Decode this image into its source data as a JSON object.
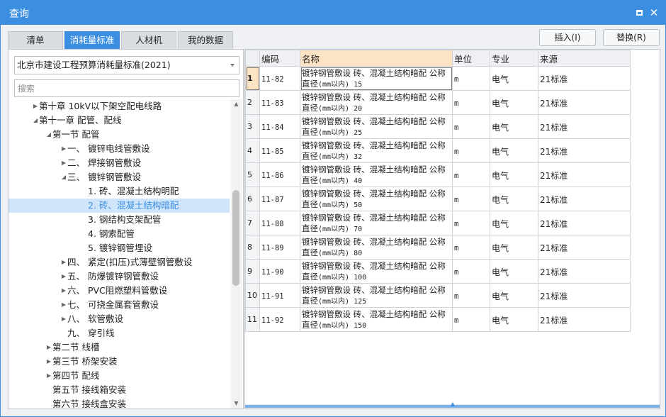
{
  "window": {
    "title": "查询"
  },
  "tabs": [
    {
      "label": "清单",
      "active": false
    },
    {
      "label": "消耗量标准",
      "active": true
    },
    {
      "label": "人材机",
      "active": false
    },
    {
      "label": "我的数据",
      "active": false
    }
  ],
  "toolbar": {
    "insert_label": "插入(I)",
    "replace_label": "替换(R)"
  },
  "standard_select": {
    "value": "北京市建设工程预算消耗量标准(2021)"
  },
  "search": {
    "placeholder": "搜索"
  },
  "tree": [
    {
      "label": "第十章 10kV以下架空配电线路",
      "toggle": "▶",
      "selected": false
    },
    {
      "label": "第十一章 配管、配线",
      "toggle": "◢",
      "selected": false
    },
    {
      "label": "第一节 配管",
      "toggle": "◢",
      "selected": false
    },
    {
      "label": "一、 镀锌电线管敷设",
      "toggle": "▶",
      "selected": false
    },
    {
      "label": "二、 焊接钢管敷设",
      "toggle": "▶",
      "selected": false
    },
    {
      "label": "三、 镀锌钢管敷设",
      "toggle": "◢",
      "selected": false
    },
    {
      "label": "1. 砖、混凝土结构明配",
      "toggle": "",
      "selected": false
    },
    {
      "label": "2. 砖、混凝土结构暗配",
      "toggle": "",
      "selected": true
    },
    {
      "label": "3. 钢结构支架配管",
      "toggle": "",
      "selected": false
    },
    {
      "label": "4. 钢索配管",
      "toggle": "",
      "selected": false
    },
    {
      "label": "5. 镀锌钢管埋设",
      "toggle": "",
      "selected": false
    },
    {
      "label": "四、 紧定(扣压)式薄壁钢管敷设",
      "toggle": "▶",
      "selected": false
    },
    {
      "label": "五、 防爆镀锌钢管敷设",
      "toggle": "▶",
      "selected": false
    },
    {
      "label": "六、 PVC阻燃塑料管敷设",
      "toggle": "▶",
      "selected": false
    },
    {
      "label": "七、 可挠金属套管敷设",
      "toggle": "▶",
      "selected": false
    },
    {
      "label": "八、 软管敷设",
      "toggle": "▶",
      "selected": false
    },
    {
      "label": "九、 穿引线",
      "toggle": "",
      "selected": false
    },
    {
      "label": "第二节 线槽",
      "toggle": "▶",
      "selected": false
    },
    {
      "label": "第三节 桥架安装",
      "toggle": "▶",
      "selected": false
    },
    {
      "label": "第四节 配线",
      "toggle": "▶",
      "selected": false
    },
    {
      "label": "第五节 接线箱安装",
      "toggle": "",
      "selected": false
    },
    {
      "label": "第六节 接线盒安装",
      "toggle": "",
      "selected": false
    }
  ],
  "grid": {
    "columns": [
      "",
      "编码",
      "名称",
      "单位",
      "专业",
      "来源"
    ],
    "rows": [
      {
        "no": "1",
        "code": "11-82",
        "name": "镀锌钢管敷设 砖、混凝土结构暗配 公称直径",
        "size": "(mm以内) 15",
        "unit": "m",
        "major": "电气",
        "source": "21标准"
      },
      {
        "no": "2",
        "code": "11-83",
        "name": "镀锌钢管敷设 砖、混凝土结构暗配 公称直径",
        "size": "(mm以内) 20",
        "unit": "m",
        "major": "电气",
        "source": "21标准"
      },
      {
        "no": "3",
        "code": "11-84",
        "name": "镀锌钢管敷设 砖、混凝土结构暗配 公称直径",
        "size": "(mm以内) 25",
        "unit": "m",
        "major": "电气",
        "source": "21标准"
      },
      {
        "no": "4",
        "code": "11-85",
        "name": "镀锌钢管敷设 砖、混凝土结构暗配 公称直径",
        "size": "(mm以内) 32",
        "unit": "m",
        "major": "电气",
        "source": "21标准"
      },
      {
        "no": "5",
        "code": "11-86",
        "name": "镀锌钢管敷设 砖、混凝土结构暗配 公称直径",
        "size": "(mm以内) 40",
        "unit": "m",
        "major": "电气",
        "source": "21标准"
      },
      {
        "no": "6",
        "code": "11-87",
        "name": "镀锌钢管敷设 砖、混凝土结构暗配 公称直径",
        "size": "(mm以内) 50",
        "unit": "m",
        "major": "电气",
        "source": "21标准"
      },
      {
        "no": "7",
        "code": "11-88",
        "name": "镀锌钢管敷设 砖、混凝土结构暗配 公称直径",
        "size": "(mm以内) 70",
        "unit": "m",
        "major": "电气",
        "source": "21标准"
      },
      {
        "no": "8",
        "code": "11-89",
        "name": "镀锌钢管敷设 砖、混凝土结构暗配 公称直径",
        "size": "(mm以内) 80",
        "unit": "m",
        "major": "电气",
        "source": "21标准"
      },
      {
        "no": "9",
        "code": "11-90",
        "name": "镀锌钢管敷设 砖、混凝土结构暗配 公称直径",
        "size": "(mm以内) 100",
        "unit": "m",
        "major": "电气",
        "source": "21标准"
      },
      {
        "no": "10",
        "code": "11-91",
        "name": "镀锌钢管敷设 砖、混凝土结构暗配 公称直径",
        "size": "(mm以内) 125",
        "unit": "m",
        "major": "电气",
        "source": "21标准"
      },
      {
        "no": "11",
        "code": "11-92",
        "name": "镀锌钢管敷设 砖、混凝土结构暗配 公称直径",
        "size": "(mm以内) 150",
        "unit": "m",
        "major": "电气",
        "source": "21标准"
      }
    ]
  },
  "colors": {
    "accent": "#3c8ee0",
    "selected_bg": "#cfe5fb",
    "active_header": "#fbe3c4"
  }
}
